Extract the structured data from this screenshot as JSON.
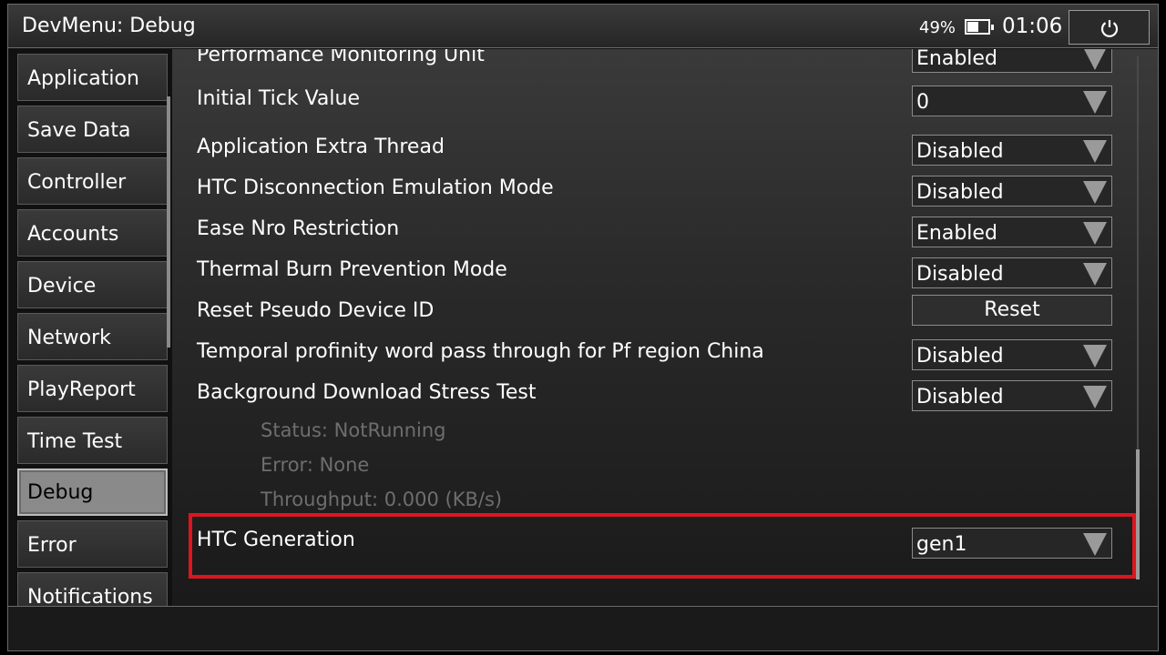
{
  "window": {
    "title": "DevMenu: Debug"
  },
  "status": {
    "battery_percent": "49%",
    "battery_level": 0.49,
    "clock": "01:06"
  },
  "sidebar": {
    "items": [
      {
        "label": "Application"
      },
      {
        "label": "Save Data"
      },
      {
        "label": "Controller"
      },
      {
        "label": "Accounts"
      },
      {
        "label": "Device"
      },
      {
        "label": "Network"
      },
      {
        "label": "PlayReport"
      },
      {
        "label": "Time Test"
      },
      {
        "label": "Debug",
        "active": true
      },
      {
        "label": "Error"
      },
      {
        "label": "Notifications"
      }
    ]
  },
  "settings": [
    {
      "label": "Performance Monitoring Unit",
      "value": "Enabled",
      "control": "dropdown"
    },
    {
      "label": "Initial Tick Value",
      "value": "0",
      "control": "dropdown"
    },
    {
      "label": "Application Extra Thread",
      "value": "Disabled",
      "control": "dropdown"
    },
    {
      "label": "HTC Disconnection Emulation Mode",
      "value": "Disabled",
      "control": "dropdown"
    },
    {
      "label": "Ease Nro Restriction",
      "value": "Enabled",
      "control": "dropdown"
    },
    {
      "label": "Thermal Burn Prevention Mode",
      "value": "Disabled",
      "control": "dropdown"
    },
    {
      "label": "Reset Pseudo Device ID",
      "value": "Reset",
      "control": "button"
    },
    {
      "label": "Temporal profinity word pass through for Pf region China",
      "value": "Disabled",
      "control": "dropdown"
    },
    {
      "label": "Background Download Stress Test",
      "value": "Disabled",
      "control": "dropdown"
    },
    {
      "label": "HTC Generation",
      "value": "gen1",
      "control": "dropdown"
    }
  ],
  "stress_test_info": {
    "status": "Status:  NotRunning",
    "error": "Error:  None",
    "throughput": "Throughput:  0.000 (KB/s)"
  },
  "colors": {
    "highlight": "#e0141e",
    "active_tab": "#8a8a8a"
  }
}
